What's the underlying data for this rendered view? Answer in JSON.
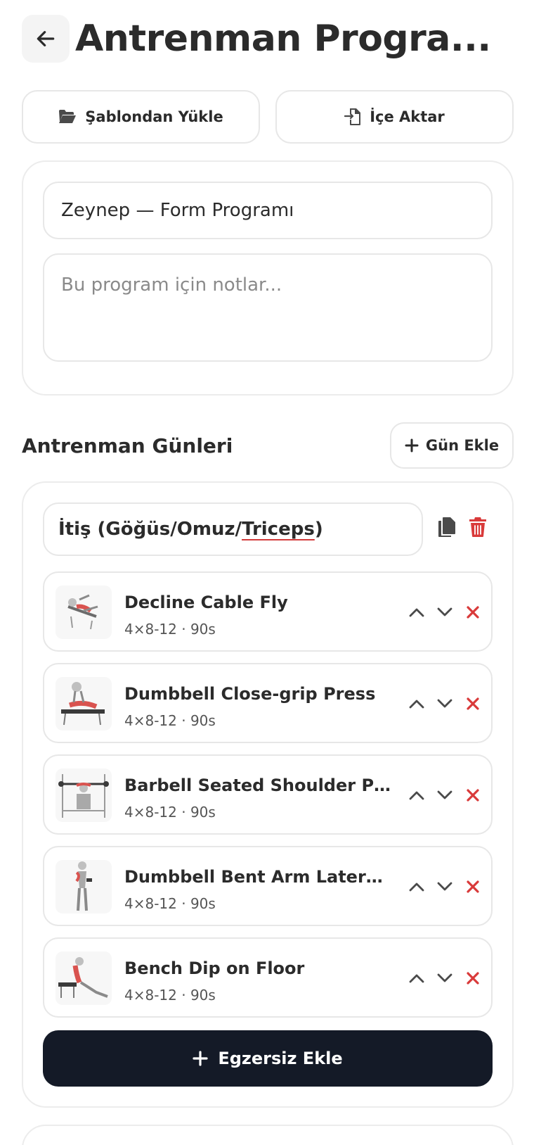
{
  "header": {
    "title": "Antrenman Progra...",
    "back_icon": "arrow-left-icon"
  },
  "top_actions": {
    "load_template_label": "Şablondan Yükle",
    "load_template_icon": "folder-open-icon",
    "import_label": "İçe Aktar",
    "import_icon": "file-import-icon"
  },
  "program": {
    "name_value": "Zeynep — Form Programı",
    "notes_placeholder": "Bu program için notlar..."
  },
  "days_section": {
    "title": "Antrenman Günleri",
    "add_day_label": "Gün Ekle"
  },
  "day": {
    "name_prefix": "İtiş (Göğüs/Omuz/",
    "name_underlined": "Triceps",
    "name_suffix": ")",
    "copy_icon": "copy-icon",
    "delete_icon": "trash-icon",
    "exercises": [
      {
        "name": "Decline Cable Fly",
        "meta": "4×8-12 · 90s"
      },
      {
        "name": "Dumbbell Close-grip Press",
        "meta": "4×8-12 · 90s"
      },
      {
        "name": "Barbell Seated Shoulder Press",
        "meta": "4×8-12 · 90s"
      },
      {
        "name": "Dumbbell Bent Arm Lateral Raise",
        "meta": "4×8-12 · 90s"
      },
      {
        "name": "Bench Dip on Floor",
        "meta": "4×8-12 · 90s"
      }
    ],
    "add_exercise_label": "Egzersiz Ekle"
  },
  "colors": {
    "accent_red": "#d93a3a",
    "dark_button": "#141a27",
    "border": "#e7e7e7"
  }
}
